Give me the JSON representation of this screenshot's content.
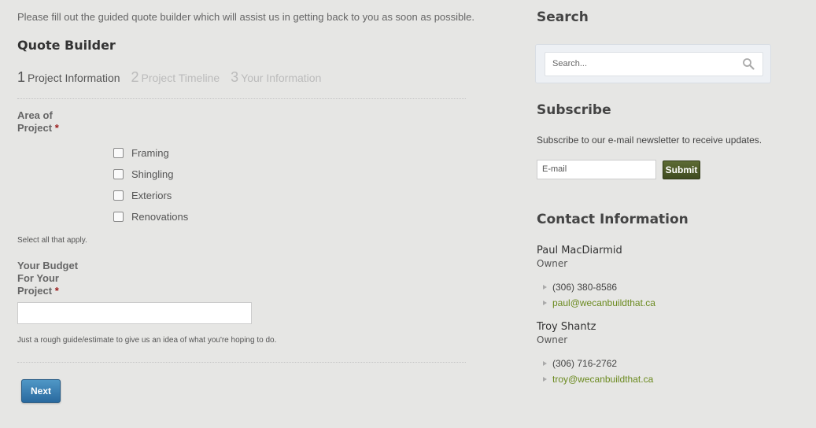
{
  "main": {
    "intro": "Please fill out the guided quote builder which will assist us in getting back to you as soon as possible.",
    "title": "Quote Builder",
    "steps": [
      {
        "num": "1",
        "label": "Project Information"
      },
      {
        "num": "2",
        "label": "Project Timeline"
      },
      {
        "num": "3",
        "label": "Your Information"
      }
    ],
    "area": {
      "label_line1": "Area of",
      "label_line2": "Project",
      "required": "*",
      "options": [
        "Framing",
        "Shingling",
        "Exteriors",
        "Renovations"
      ],
      "help": "Select all that apply."
    },
    "budget": {
      "label_line1": "Your Budget",
      "label_line2": "For Your",
      "label_line3": "Project",
      "required": "*",
      "value": "",
      "help": "Just a rough guide/estimate to give us an idea of what you're hoping to do."
    },
    "next_label": "Next"
  },
  "sidebar": {
    "search": {
      "heading": "Search",
      "placeholder": "Search..."
    },
    "subscribe": {
      "heading": "Subscribe",
      "text": "Subscribe to our e-mail newsletter to receive updates.",
      "email_placeholder": "E-mail",
      "submit_label": "Submit"
    },
    "contact": {
      "heading": "Contact Information",
      "people": [
        {
          "name": "Paul MacDiarmid",
          "role": "Owner",
          "phone": "(306) 380-8586",
          "email": "paul@wecanbuildthat.ca"
        },
        {
          "name": "Troy Shantz",
          "role": "Owner",
          "phone": "(306) 716-2762",
          "email": "troy@wecanbuildthat.ca"
        }
      ]
    }
  }
}
